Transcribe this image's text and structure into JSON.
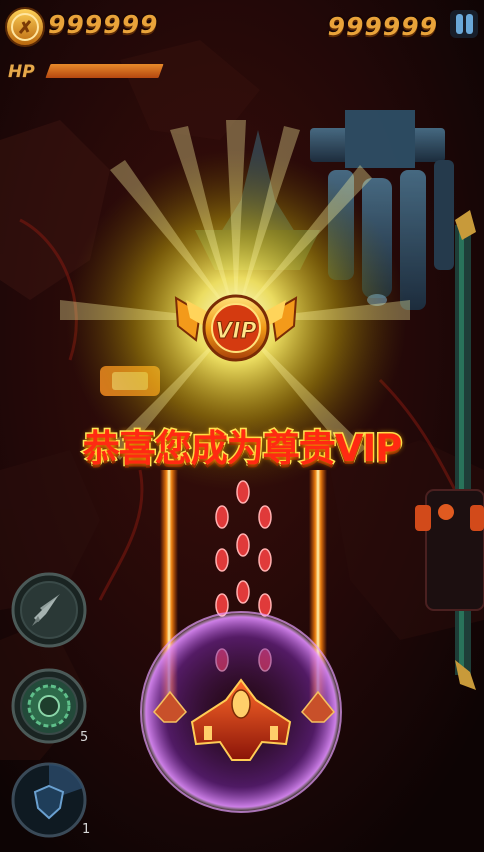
{
  "hud": {
    "coins": "999999",
    "score": "999999",
    "hp_label": "HP",
    "hp_level": 0.75
  },
  "popup": {
    "badge_text": "VIP",
    "message": "恭喜您成为尊贵VIP"
  },
  "skills": {
    "bomb_count": "5",
    "shield_count": "1"
  },
  "icons": [
    "coin-icon",
    "pause-icon",
    "vip-badge-icon",
    "missile-icon",
    "bomb-icon",
    "shield-icon"
  ],
  "colors": {
    "accent": "#e9a33a",
    "banner_red": "#ff2a12",
    "banner_outline": "#fff26a",
    "background": "#120606"
  }
}
